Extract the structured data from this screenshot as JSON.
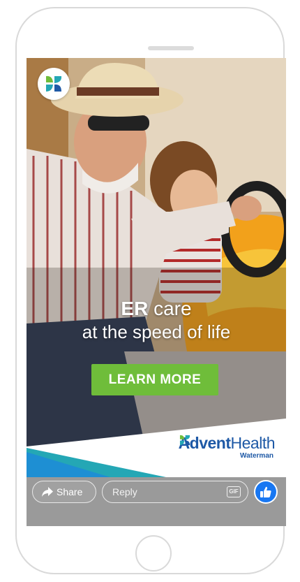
{
  "ad": {
    "headline_bold": "ER",
    "headline_rest": " care",
    "subheadline": "at the speed of life",
    "cta_label": "LEARN MORE"
  },
  "brand": {
    "name_bold": "Advent",
    "name_light": "Health",
    "sub": "Waterman",
    "colors": {
      "blue": "#1e59a6",
      "green": "#6fbd3a",
      "teal": "#24a7b5"
    }
  },
  "actions": {
    "share_label": "Share",
    "reply_placeholder": "Reply",
    "gif_label": "GIF"
  },
  "icons": {
    "share": "share-arrow-icon",
    "like": "thumbs-up-icon",
    "gif": "gif-icon",
    "logo": "adventhealth-logo-icon"
  },
  "colors": {
    "like_blue": "#1877f2",
    "bar_gray": "#9a9a9a"
  }
}
